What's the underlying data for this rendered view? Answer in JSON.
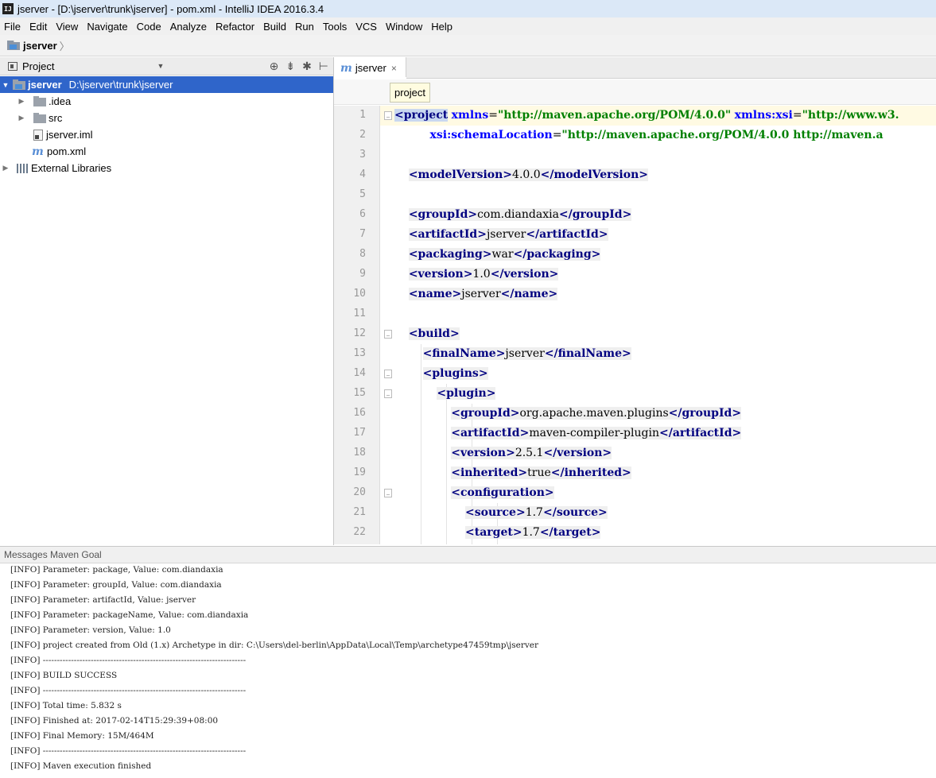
{
  "window": {
    "app_icon": "IJ",
    "title": "jserver - [D:\\jserver\\trunk\\jserver] - pom.xml - IntelliJ IDEA 2016.3.4"
  },
  "menu": [
    "File",
    "Edit",
    "View",
    "Navigate",
    "Code",
    "Analyze",
    "Refactor",
    "Build",
    "Run",
    "Tools",
    "VCS",
    "Window",
    "Help"
  ],
  "navbar": {
    "crumb": "jserver"
  },
  "project_panel": {
    "title": "Project",
    "tree": [
      {
        "label": "jserver",
        "path": "D:\\jserver\\trunk\\jserver",
        "type": "module",
        "expanded": true,
        "selected": true
      },
      {
        "label": ".idea",
        "type": "folder"
      },
      {
        "label": "src",
        "type": "folder"
      },
      {
        "label": "jserver.iml",
        "type": "iml"
      },
      {
        "label": "pom.xml",
        "type": "maven"
      },
      {
        "label": "External Libraries",
        "type": "library"
      }
    ]
  },
  "editor": {
    "tab_label": "jserver",
    "tab_icon": "m",
    "tab_close": "×",
    "breadcrumb": "project",
    "line_numbers": [
      "1",
      "2",
      "3",
      "4",
      "5",
      "6",
      "7",
      "8",
      "9",
      "10",
      "11",
      "12",
      "13",
      "14",
      "15",
      "16",
      "17",
      "18",
      "19",
      "20",
      "21",
      "22"
    ]
  },
  "code": {
    "l1": {
      "tag": "project",
      "a1": "xmlns",
      "v1": "\"http://maven.apache.org/POM/4.0.0\"",
      "a2": "xmlns:xsi",
      "v2": "\"http://www.w3."
    },
    "l2": {
      "a": "xsi:schemaLocation",
      "v": "\"http://maven.apache.org/POM/4.0.0 http://maven.a"
    },
    "l4": {
      "tag": "modelVersion",
      "text": "4.0.0"
    },
    "l6": {
      "tag": "groupId",
      "text": "com.diandaxia"
    },
    "l7": {
      "tag": "artifactId",
      "text": "jserver"
    },
    "l8": {
      "tag": "packaging",
      "text": "war"
    },
    "l9": {
      "tag": "version",
      "text": "1.0"
    },
    "l10": {
      "tag": "name",
      "text": "jserver"
    },
    "l12": {
      "tag": "build"
    },
    "l13": {
      "tag": "finalName",
      "text": "jserver"
    },
    "l14": {
      "tag": "plugins"
    },
    "l15": {
      "tag": "plugin"
    },
    "l16": {
      "tag": "groupId",
      "text": "org.apache.maven.plugins"
    },
    "l17": {
      "tag": "artifactId",
      "text": "maven-compiler-plugin"
    },
    "l18": {
      "tag": "version",
      "text": "2.5.1"
    },
    "l19": {
      "tag": "inherited",
      "text": "true"
    },
    "l20": {
      "tag": "configuration"
    },
    "l21": {
      "tag": "source",
      "text": "1.7"
    },
    "l22": {
      "tag": "target",
      "text": "1.7"
    }
  },
  "messages": {
    "title": "Messages Maven Goal",
    "lines": [
      "[INFO] Parameter: package, Value: com.diandaxia",
      "[INFO] Parameter: groupId, Value: com.diandaxia",
      "[INFO] Parameter: artifactId, Value: jserver",
      "[INFO] Parameter: packageName, Value: com.diandaxia",
      "[INFO] Parameter: version, Value: 1.0",
      "[INFO] project created from Old (1.x) Archetype in dir: C:\\Users\\del-berlin\\AppData\\Local\\Temp\\archetype47459tmp\\jserver",
      "[INFO] ------------------------------------------------------------------------",
      "[INFO] BUILD SUCCESS",
      "[INFO] ------------------------------------------------------------------------",
      "[INFO] Total time: 5.832 s",
      "[INFO] Finished at: 2017-02-14T15:29:39+08:00",
      "[INFO] Final Memory: 15M/464M",
      "[INFO] ------------------------------------------------------------------------",
      "[INFO] Maven execution finished"
    ]
  }
}
